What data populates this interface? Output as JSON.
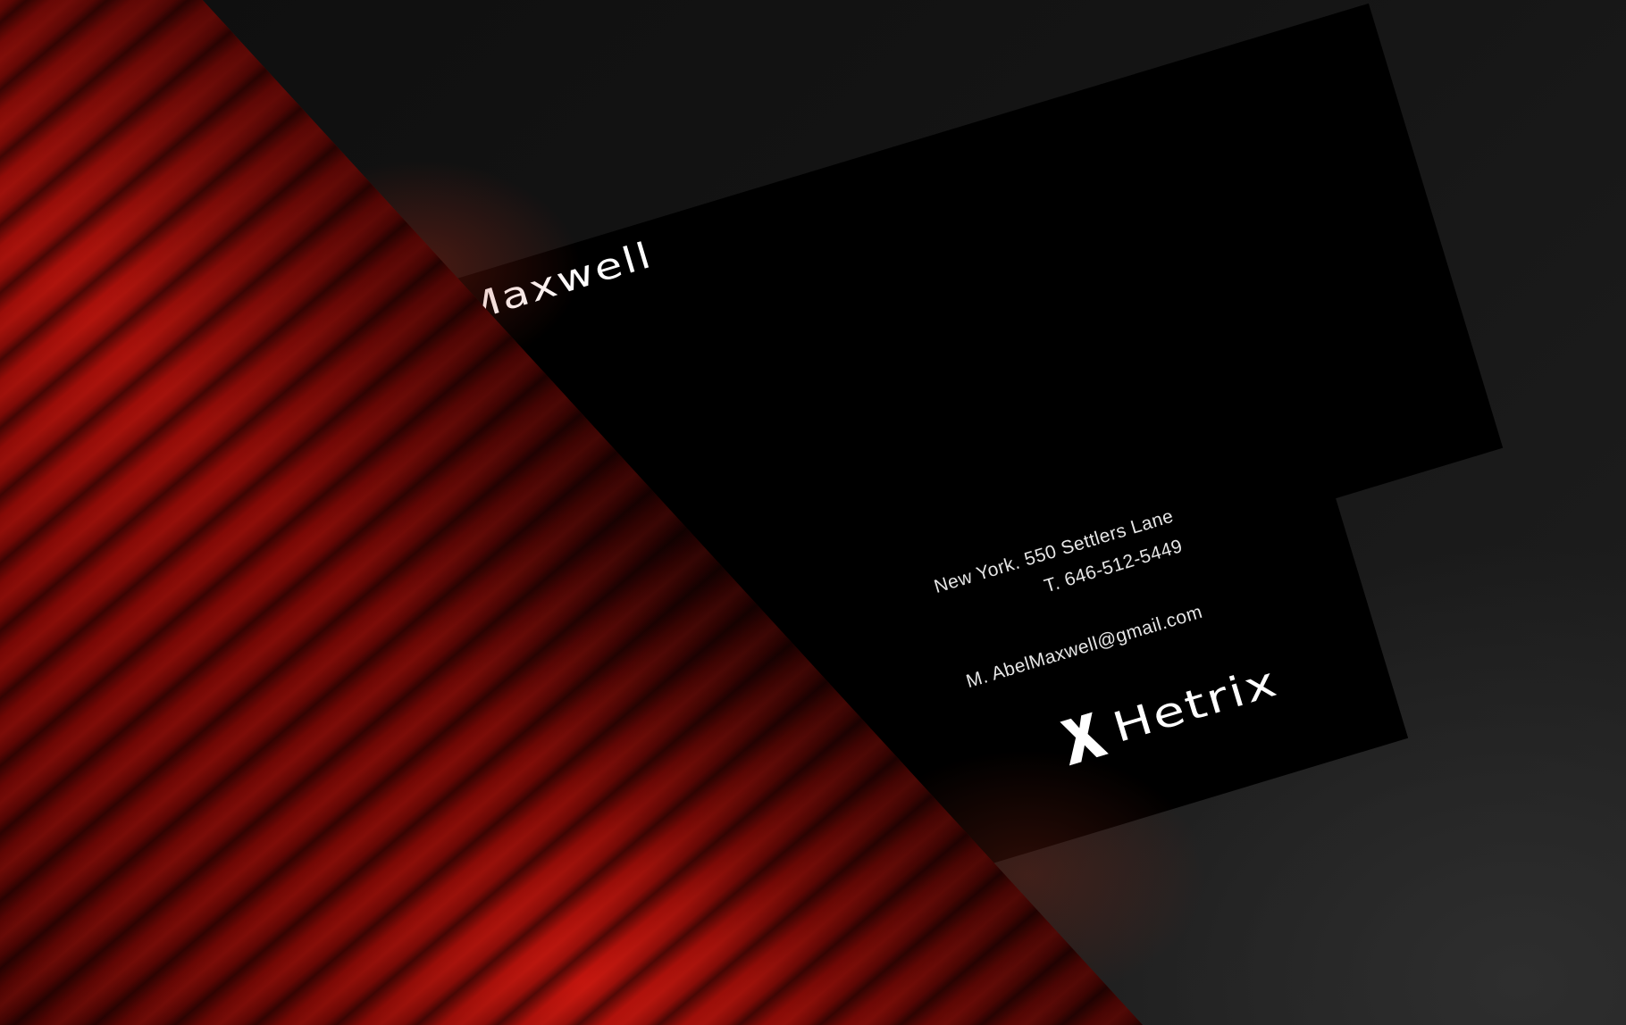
{
  "card_back": {
    "name_fragment": "Maxwell"
  },
  "card_front": {
    "address": "New York. 550 Settlers Lane",
    "phone": "T. 646-512-5449",
    "email": "M. AbelMaxwell@gmail.com",
    "brand": "Hetrix"
  },
  "colors": {
    "background": "#151515",
    "card": "#000000",
    "accent_red": "#b0110b",
    "text": "#ffffff"
  },
  "icons": {
    "logo": "hetrix-x-logo-icon"
  }
}
